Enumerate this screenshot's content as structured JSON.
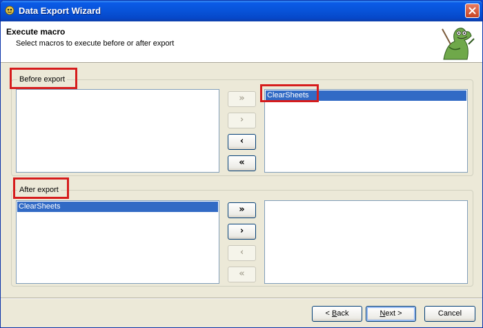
{
  "window": {
    "title": "Data Export Wizard"
  },
  "header": {
    "title": "Execute macro",
    "subtitle": "Select macros to execute before or after export"
  },
  "before_group": {
    "label": "Before export",
    "available_items": [],
    "selected_items": [
      "ClearSheets"
    ],
    "move_all_right": "»",
    "move_right": "›",
    "move_left": "‹",
    "move_all_left": "«"
  },
  "after_group": {
    "label": "After export",
    "available_items": [
      "ClearSheets"
    ],
    "selected_items": [],
    "move_all_right": "»",
    "move_right": "›",
    "move_left": "‹",
    "move_all_left": "«"
  },
  "nav": {
    "back_prefix": "< ",
    "back_mnemonic": "B",
    "back_rest": "ack",
    "next_mnemonic": "N",
    "next_rest": "ext >",
    "cancel": "Cancel"
  },
  "colors": {
    "selection": "#316ac5",
    "highlight_box": "#d61c1c",
    "titlebar": "#0853d8"
  }
}
